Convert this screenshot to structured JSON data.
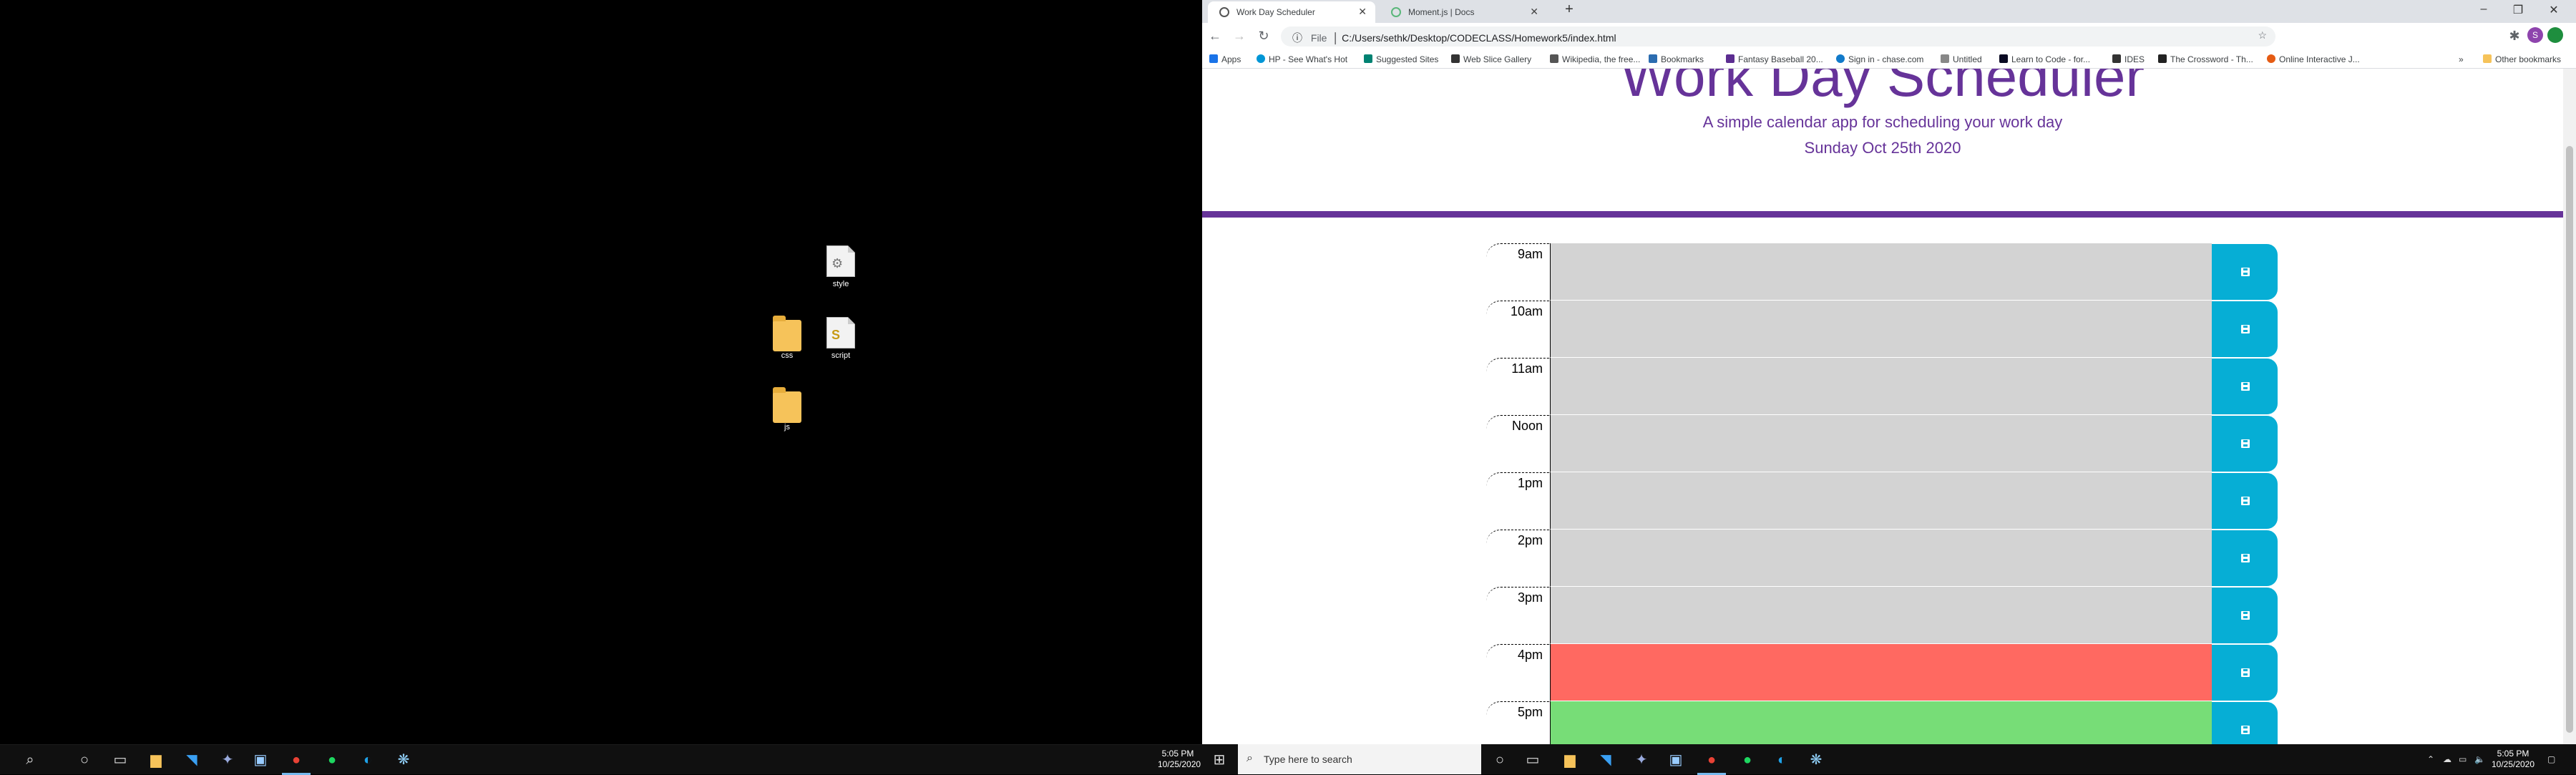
{
  "desktop": {
    "icons": [
      {
        "label": "style",
        "kind": "file"
      },
      {
        "label": "css",
        "kind": "folder"
      },
      {
        "label": "script",
        "kind": "script"
      },
      {
        "label": "js",
        "kind": "folder"
      }
    ]
  },
  "taskbar_left": {
    "clock_time": "5:05 PM",
    "clock_date": "10/25/2020"
  },
  "taskbar_right": {
    "search_placeholder": "Type here to search",
    "clock_time": "5:05 PM",
    "clock_date": "10/25/2020"
  },
  "browser": {
    "tabs": [
      {
        "title": "Work Day Scheduler",
        "active": true
      },
      {
        "title": "Moment.js | Docs",
        "active": false
      }
    ],
    "address": {
      "scheme": "File",
      "url": "C:/Users/sethk/Desktop/CODECLASS/Homework5/index.html"
    },
    "bookmarks": [
      {
        "label": "Apps",
        "color": "#1a73e8"
      },
      {
        "label": "HP - See What's Hot",
        "color": "#0096d6"
      },
      {
        "label": "Suggested Sites",
        "color": "#008272"
      },
      {
        "label": "Web Slice Gallery",
        "color": "#333333"
      },
      {
        "label": "Wikipedia, the free...",
        "color": "#555555"
      },
      {
        "label": "Bookmarks",
        "color": "#2b6cb0"
      },
      {
        "label": "Fantasy Baseball 20...",
        "color": "#5c2d91"
      },
      {
        "label": "Sign in - chase.com",
        "color": "#117aca"
      },
      {
        "label": "Untitled",
        "color": "#888888"
      },
      {
        "label": "Learn to Code - for...",
        "color": "#0a0a23"
      },
      {
        "label": "IDES",
        "color": "#333333"
      },
      {
        "label": "The Crossword - Th...",
        "color": "#222222"
      },
      {
        "label": "Online Interactive J...",
        "color": "#e55b13"
      }
    ],
    "other_bookmarks": "Other bookmarks"
  },
  "page": {
    "title": "Work Day Scheduler",
    "lead": "A simple calendar app for scheduling your work day",
    "date": "Sunday Oct 25th 2020",
    "colors": {
      "accent": "#663399",
      "past": "#d3d3d3",
      "present": "#ff6961",
      "future": "#77dd77",
      "save": "#06aed5"
    },
    "hours": [
      {
        "label": "9am",
        "state": "past"
      },
      {
        "label": "10am",
        "state": "past"
      },
      {
        "label": "11am",
        "state": "past"
      },
      {
        "label": "Noon",
        "state": "past"
      },
      {
        "label": "1pm",
        "state": "past"
      },
      {
        "label": "2pm",
        "state": "past"
      },
      {
        "label": "3pm",
        "state": "past"
      },
      {
        "label": "4pm",
        "state": "present"
      },
      {
        "label": "5pm",
        "state": "future"
      }
    ]
  }
}
